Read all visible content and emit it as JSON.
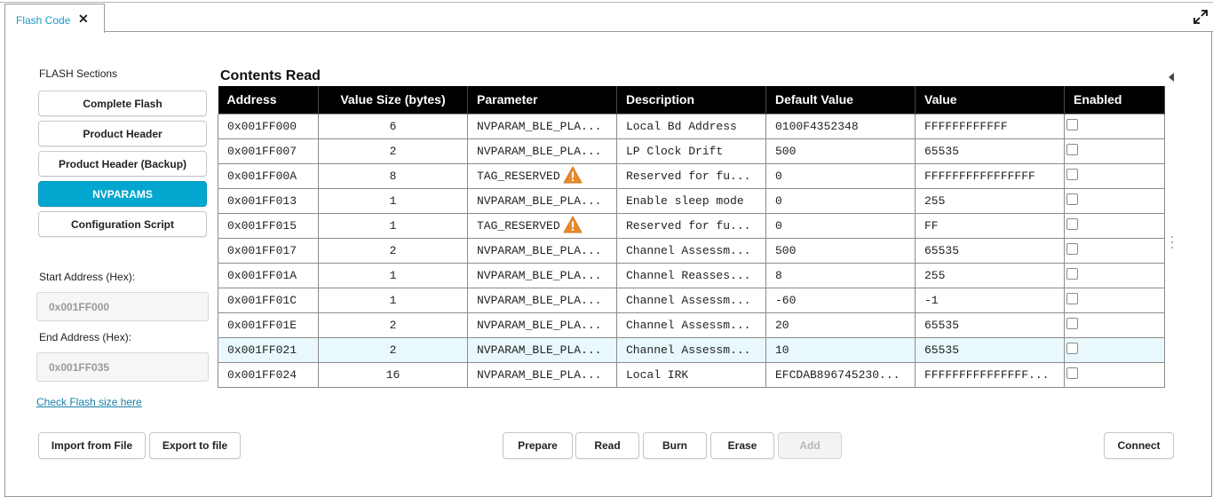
{
  "tab": {
    "label": "Flash Code",
    "close_glyph": "✕"
  },
  "icons": {
    "close": "close-icon",
    "expand": "expand-icon",
    "warning": "warning-icon",
    "collapse": "chevron-left-icon"
  },
  "colors": {
    "accent": "#02a6cf",
    "tab_text": "#1a9bc4",
    "link": "#1a7fa8",
    "warning": "#e88a2e",
    "table_header_bg": "#000000",
    "highlight_row": "#e9f8fc"
  },
  "sidebar": {
    "title": "FLASH Sections",
    "sections": [
      {
        "label": "Complete Flash",
        "active": false
      },
      {
        "label": "Product Header",
        "active": false
      },
      {
        "label": "Product Header (Backup)",
        "active": false
      },
      {
        "label": "NVPARAMS",
        "active": true
      },
      {
        "label": "Configuration Script",
        "active": false
      }
    ],
    "start_label": "Start Address (Hex):",
    "start_value": "0x001FF000",
    "end_label": "End Address (Hex):",
    "end_value": "0x001FF035",
    "link": "Check Flash size here"
  },
  "contents": {
    "title": "Contents Read",
    "columns": [
      "Address",
      "Value Size (bytes)",
      "Parameter",
      "Description",
      "Default Value",
      "Value",
      "Enabled"
    ],
    "rows": [
      {
        "address": "0x001FF000",
        "size": "6",
        "parameter": "NVPARAM_BLE_PLA...",
        "warning": false,
        "description": "Local Bd Address",
        "default": "0100F4352348",
        "value": "FFFFFFFFFFFF",
        "enabled": false,
        "highlight": false
      },
      {
        "address": "0x001FF007",
        "size": "2",
        "parameter": "NVPARAM_BLE_PLA...",
        "warning": false,
        "description": "LP Clock Drift",
        "default": "500",
        "value": "65535",
        "enabled": false,
        "highlight": false
      },
      {
        "address": "0x001FF00A",
        "size": "8",
        "parameter": "TAG_RESERVED",
        "warning": true,
        "description": "Reserved for fu...",
        "default": "0",
        "value": "FFFFFFFFFFFFFFFF",
        "enabled": false,
        "highlight": false
      },
      {
        "address": "0x001FF013",
        "size": "1",
        "parameter": "NVPARAM_BLE_PLA...",
        "warning": false,
        "description": "Enable sleep mode",
        "default": "0",
        "value": "255",
        "enabled": false,
        "highlight": false
      },
      {
        "address": "0x001FF015",
        "size": "1",
        "parameter": "TAG_RESERVED",
        "warning": true,
        "description": "Reserved for fu...",
        "default": "0",
        "value": "FF",
        "enabled": false,
        "highlight": false
      },
      {
        "address": "0x001FF017",
        "size": "2",
        "parameter": "NVPARAM_BLE_PLA...",
        "warning": false,
        "description": "Channel Assessm...",
        "default": "500",
        "value": "65535",
        "enabled": false,
        "highlight": false
      },
      {
        "address": "0x001FF01A",
        "size": "1",
        "parameter": "NVPARAM_BLE_PLA...",
        "warning": false,
        "description": "Channel Reasses...",
        "default": "8",
        "value": "255",
        "enabled": false,
        "highlight": false
      },
      {
        "address": "0x001FF01C",
        "size": "1",
        "parameter": "NVPARAM_BLE_PLA...",
        "warning": false,
        "description": "Channel Assessm...",
        "default": "-60",
        "value": "-1",
        "enabled": false,
        "highlight": false
      },
      {
        "address": "0x001FF01E",
        "size": "2",
        "parameter": "NVPARAM_BLE_PLA...",
        "warning": false,
        "description": "Channel Assessm...",
        "default": "20",
        "value": "65535",
        "enabled": false,
        "highlight": false
      },
      {
        "address": "0x001FF021",
        "size": "2",
        "parameter": "NVPARAM_BLE_PLA...",
        "warning": false,
        "description": "Channel Assessm...",
        "default": "10",
        "value": "65535",
        "enabled": false,
        "highlight": true
      },
      {
        "address": "0x001FF024",
        "size": "16",
        "parameter": "NVPARAM_BLE_PLA...",
        "warning": false,
        "description": "Local IRK",
        "default": "EFCDAB896745230...",
        "value": "FFFFFFFFFFFFFFF...",
        "enabled": false,
        "highlight": false
      }
    ]
  },
  "toolbar": {
    "import": "Import from File",
    "export": "Export to file",
    "prepare": "Prepare",
    "read": "Read",
    "burn": "Burn",
    "erase": "Erase",
    "add": "Add",
    "connect": "Connect"
  }
}
